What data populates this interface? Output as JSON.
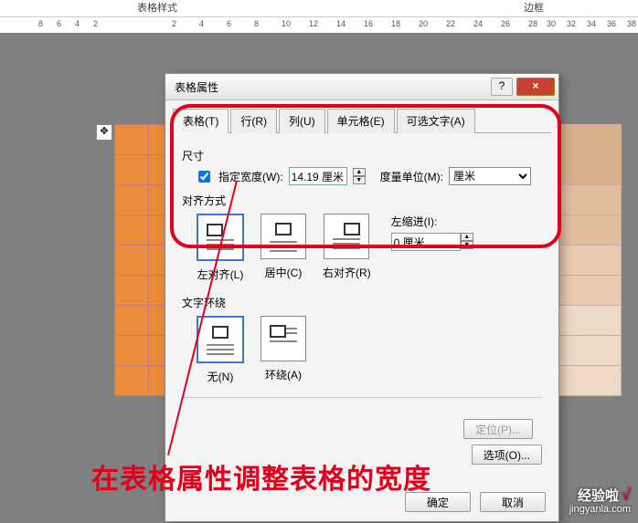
{
  "ribbon": {
    "style_label": "表格样式",
    "border_label": "边框"
  },
  "ruler": {
    "marks": [
      "8",
      "6",
      "4",
      "2",
      "",
      "2",
      "4",
      "6",
      "8",
      "10",
      "12",
      "14",
      "16",
      "18",
      "20",
      "22",
      "24",
      "26",
      "28",
      "30",
      "32",
      "34",
      "36",
      "38"
    ]
  },
  "dialog": {
    "title": "表格属性",
    "help": "?",
    "close": "×",
    "tabs": {
      "table": "表格(T)",
      "row": "行(R)",
      "col": "列(U)",
      "cell": "单元格(E)",
      "alt": "可选文字(A)"
    },
    "size_label": "尺寸",
    "width_cb": "指定宽度(W):",
    "width_val": "14.19 厘米",
    "unit_label": "度量单位(M):",
    "unit_val": "厘米",
    "align_label": "对齐方式",
    "align": {
      "left": "左对齐(L)",
      "center": "居中(C)",
      "right": "右对齐(R)"
    },
    "indent_label": "左缩进(I):",
    "indent_val": "0 厘米",
    "wrap_label": "文字环绕",
    "wrap": {
      "none": "无(N)",
      "around": "环绕(A)"
    },
    "pos_btn": "定位(P)...",
    "opt_btn": "选项(O)...",
    "ok": "确定",
    "cancel": "取消"
  },
  "annotation": "在表格属性调整表格的宽度",
  "watermark": {
    "line1": "经验啦",
    "check": "√",
    "line2": "jingyanla.com"
  }
}
